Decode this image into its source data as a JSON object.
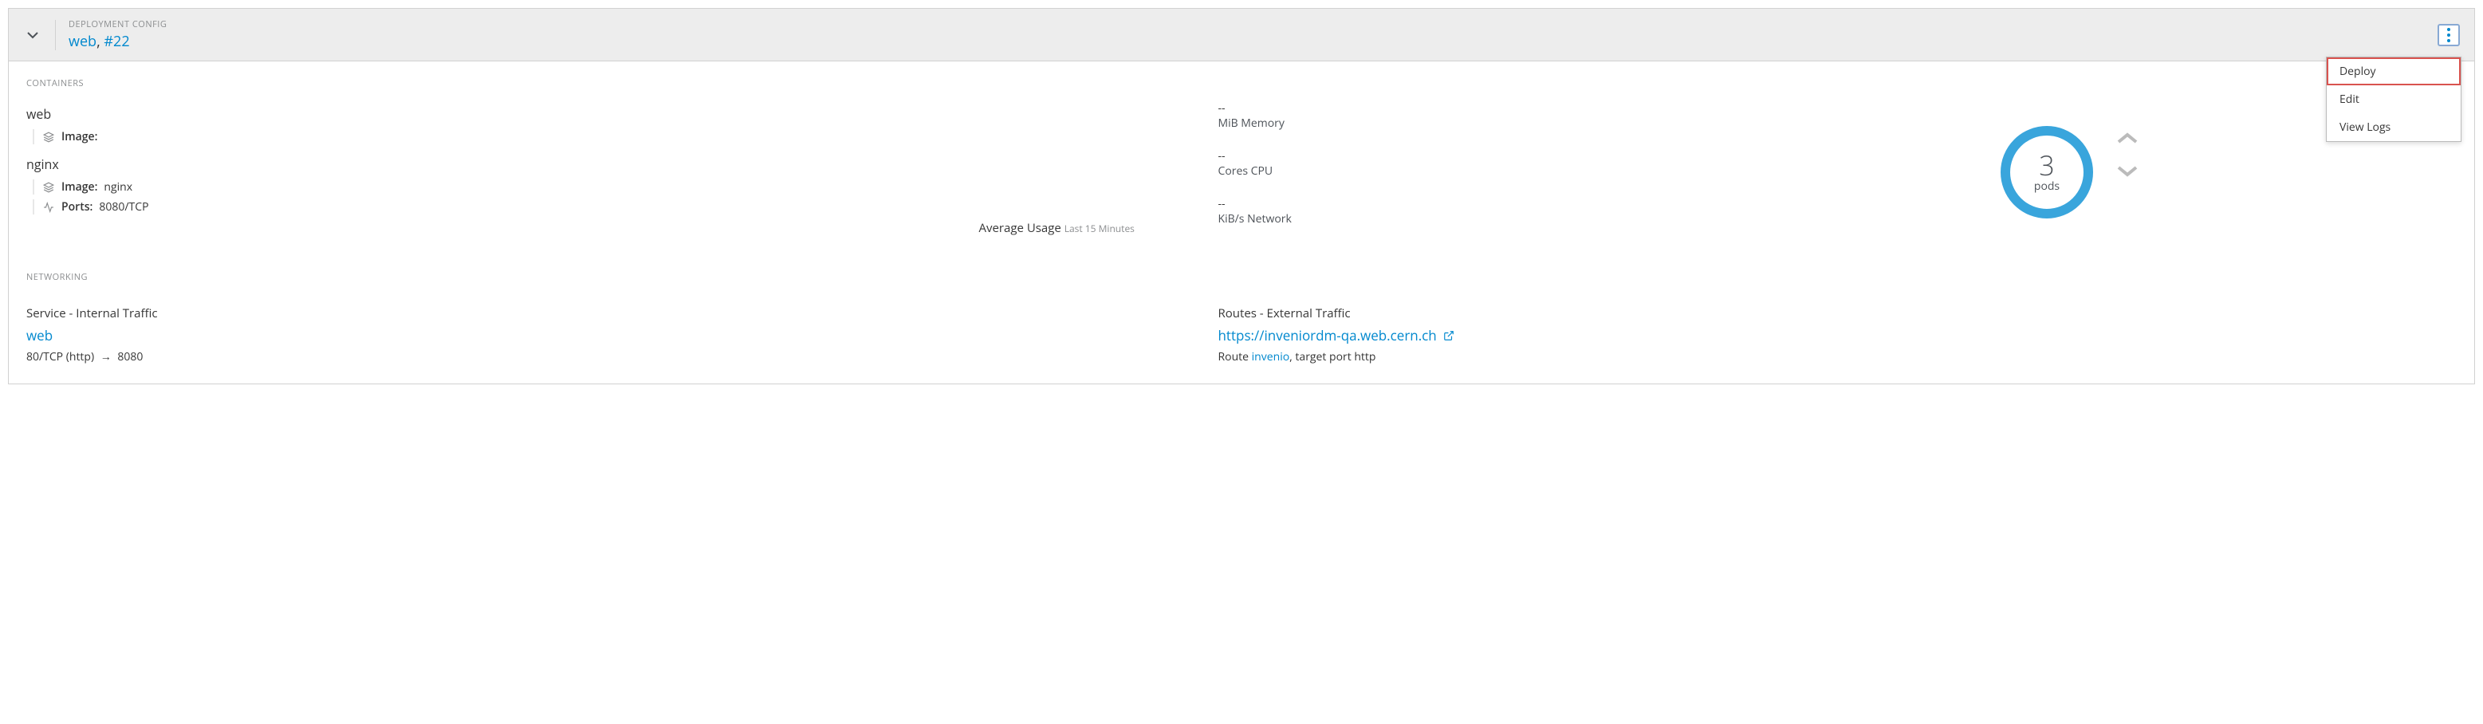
{
  "header": {
    "kicker": "DEPLOYMENT CONFIG",
    "name": "web",
    "sep": ", ",
    "revision": "#22"
  },
  "menu": {
    "deploy": "Deploy",
    "edit": "Edit",
    "view_logs": "View Logs"
  },
  "sections": {
    "containers_label": "CONTAINERS",
    "networking_label": "NETWORKING"
  },
  "containers": [
    {
      "name": "web",
      "details": [
        {
          "icon": "layers",
          "label": "Image:",
          "value": ""
        }
      ]
    },
    {
      "name": "nginx",
      "details": [
        {
          "icon": "layers",
          "label": "Image:",
          "value": "nginx"
        },
        {
          "icon": "activity",
          "label": "Ports:",
          "value": "8080/TCP"
        }
      ]
    }
  ],
  "usage": {
    "metrics": [
      {
        "value": "--",
        "label": "MiB Memory"
      },
      {
        "value": "--",
        "label": "Cores CPU"
      },
      {
        "value": "--",
        "label": "KiB/s Network"
      }
    ],
    "title": "Average Usage",
    "sub": "Last 15 Minutes"
  },
  "pod": {
    "count": "3",
    "label": "pods"
  },
  "networking": {
    "service": {
      "title": "Service - Internal Traffic",
      "link": "web",
      "port_pre": "80/TCP (http)",
      "port_post": "8080"
    },
    "route": {
      "title": "Routes - External Traffic",
      "url": "https://inveniordm-qa.web.cern.ch",
      "desc_pre": "Route ",
      "route_name": "invenio",
      "desc_post": ", target port http"
    }
  }
}
